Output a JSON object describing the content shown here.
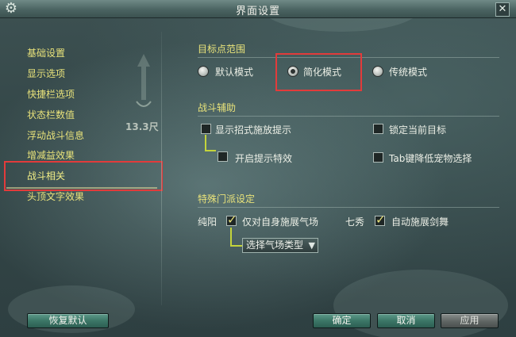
{
  "window": {
    "title": "界面设置"
  },
  "sidebar": {
    "items": [
      {
        "label": "基础设置"
      },
      {
        "label": "显示选项"
      },
      {
        "label": "快捷栏选项"
      },
      {
        "label": "状态栏数值"
      },
      {
        "label": "浮动战斗信息"
      },
      {
        "label": "增减益效果"
      },
      {
        "label": "战斗相关",
        "selected": true
      },
      {
        "label": "头顶文字效果"
      }
    ],
    "decor_distance": "13.3尺"
  },
  "target_range": {
    "heading": "目标点范围",
    "options": [
      {
        "label": "默认模式",
        "checked": false
      },
      {
        "label": "简化模式",
        "checked": true
      },
      {
        "label": "传统模式",
        "checked": false
      }
    ]
  },
  "combat_assist": {
    "heading": "战斗辅助",
    "show_skill_hint": {
      "label": "显示招式施放提示",
      "checked": false
    },
    "enable_hint_effect": {
      "label": "开启提示特效",
      "checked": false
    },
    "lock_current_target": {
      "label": "锁定当前目标",
      "checked": false
    },
    "tab_low_pet_select": {
      "label": "Tab键降低宠物选择",
      "checked": false
    }
  },
  "special_school": {
    "heading": "特殊门派设定",
    "chunyang": {
      "school": "纯阳",
      "option": {
        "label": "仅对自身施展气场",
        "checked": true
      },
      "dropdown": {
        "label": "选择气场类型",
        "arrow": "▼"
      }
    },
    "qixiu": {
      "school": "七秀",
      "option": {
        "label": "自动施展剑舞",
        "checked": true
      }
    }
  },
  "footer": {
    "restore_default": "恢复默认",
    "confirm": "确定",
    "cancel": "取消",
    "apply": "应用"
  },
  "icons": {
    "gear": "gear-icon",
    "close": "close-icon"
  },
  "colors": {
    "accent_yellow": "#e8e27a",
    "highlight_red": "#e23b3b",
    "button_teal": "#3c7767"
  }
}
